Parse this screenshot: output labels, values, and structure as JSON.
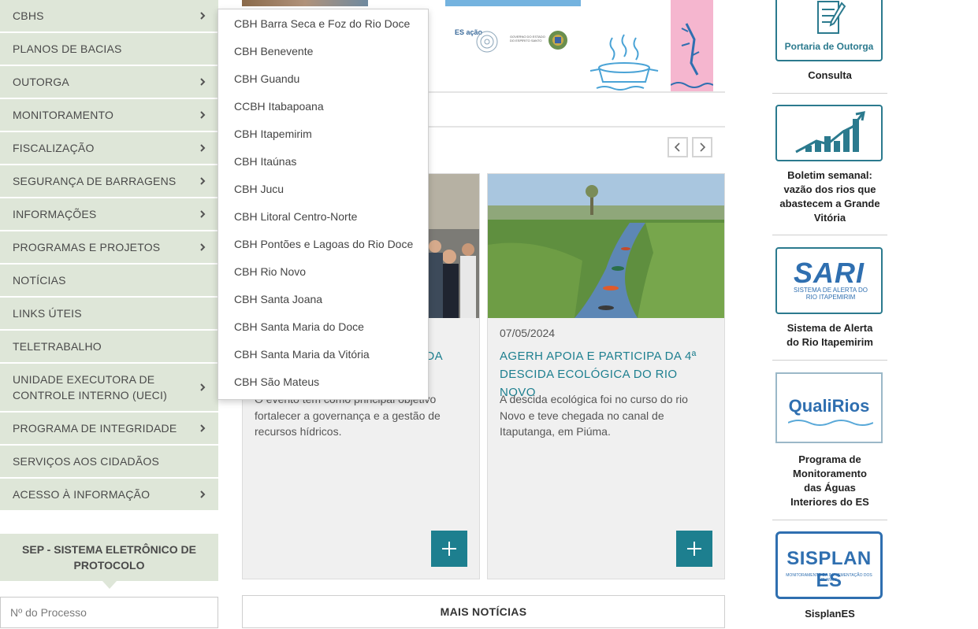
{
  "menu": {
    "items": [
      {
        "label": "CBHS",
        "arrow": true
      },
      {
        "label": "PLANOS DE BACIAS",
        "arrow": false
      },
      {
        "label": "OUTORGA",
        "arrow": true
      },
      {
        "label": "MONITORAMENTO",
        "arrow": true
      },
      {
        "label": "FISCALIZAÇÃO",
        "arrow": true
      },
      {
        "label": "SEGURANÇA DE BARRAGENS",
        "arrow": true
      },
      {
        "label": "INFORMAÇÕES",
        "arrow": true
      },
      {
        "label": "PROGRAMAS E PROJETOS",
        "arrow": true
      },
      {
        "label": "NOTÍCIAS",
        "arrow": false
      },
      {
        "label": "LINKS ÚTEIS",
        "arrow": false
      },
      {
        "label": "TELETRABALHO",
        "arrow": false
      },
      {
        "label": "UNIDADE EXECUTORA DE CONTROLE INTERNO (UECI)",
        "arrow": true
      },
      {
        "label": "PROGRAMA DE INTEGRIDADE",
        "arrow": true
      },
      {
        "label": "SERVIÇOS AOS CIDADÃOS",
        "arrow": false
      },
      {
        "label": "ACESSO À INFORMAÇÃO",
        "arrow": true
      }
    ]
  },
  "dropdown": {
    "items": [
      "CBH Barra Seca e Foz do Rio Doce",
      "CBH Benevente",
      "CBH Guandu",
      "CCBH Itabapoana",
      "CBH Itapemirim",
      "CBH Itaúnas",
      "CBH Jucu",
      "CBH Litoral Centro-Norte",
      "CBH Pontões e Lagoas do Rio Doce",
      "CBH Rio Novo",
      "CBH Santa Joana",
      "CBH Santa Maria do Doce",
      "CBH Santa Maria da Vitória",
      "CBH São Mateus"
    ]
  },
  "banner": {
    "brand": "ES ação",
    "gov_text": "GOVERNO DO ESTADO DO ESPÍRITO SANTO"
  },
  "sep": {
    "title": "SEP - SISTEMA ELETRÔNICO DE PROTOCOLO",
    "input_placeholder": "Nº do Processo"
  },
  "news": {
    "cards": [
      {
        "date": "",
        "title_visible": "RA DA",
        "excerpt": "O evento tem como principal objetivo fortalecer a governança e a gestão de recursos hídricos."
      },
      {
        "date": "07/05/2024",
        "title": "AGERH APOIA E PARTICIPA DA 4ª DESCIDA ECOLÓGICA DO RIO NOVO",
        "excerpt": "A descida ecológica foi no curso do rio Novo e teve chegada no canal de Itaputanga, em Piúma."
      }
    ],
    "more_label": "MAIS NOTÍCIAS"
  },
  "sidebar_right": {
    "items": [
      {
        "tile_text": "Portaria de Outorga",
        "label": "Consulta"
      },
      {
        "tile_text": "",
        "label": "Boletim semanal: vazão dos rios que abastecem a Grande Vitória"
      },
      {
        "tile_text": "SARI",
        "tile_sub": "SISTEMA DE ALERTA DO RIO ITAPEMIRIM",
        "label": "Sistema de Alerta do Rio Itapemirim"
      },
      {
        "tile_text": "QualiRios",
        "label": "Programa de Monitoramento das Águas Interiores do ES"
      },
      {
        "tile_text": "SISPLAN ES",
        "tile_sub": "MONITORAMENTO DA IMPLEMENTAÇÃO DOS PLANOS",
        "label": "SisplanES"
      }
    ]
  },
  "colors": {
    "menu_bg": "#dee6d8",
    "accent": "#1d7f8f",
    "tile_border": "#2b7a8e"
  }
}
